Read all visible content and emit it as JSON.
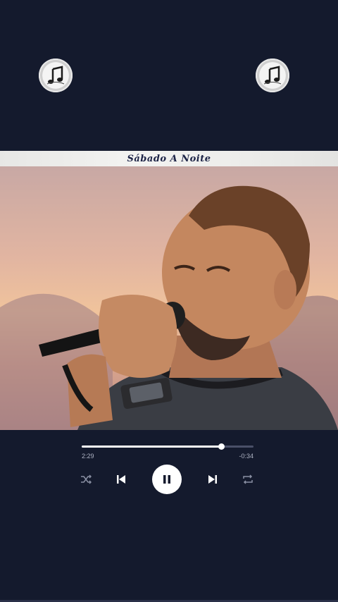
{
  "header": {
    "title": "Sábado A Noite"
  },
  "logos": {
    "left_icon": "music-note-icon",
    "right_icon": "music-note-icon"
  },
  "video": {
    "scene": "singer-with-microphone"
  },
  "player": {
    "elapsed": "2:29",
    "remaining": "-0:34",
    "progress": 0.81,
    "controls": {
      "shuffle_icon": "shuffle-icon",
      "previous_icon": "previous-track-icon",
      "pause_icon": "pause-icon",
      "next_icon": "next-track-icon",
      "repeat_icon": "repeat-icon"
    }
  },
  "colors": {
    "background": "#141a2d",
    "accent": "#ffffff",
    "title_text": "#1c2346"
  }
}
